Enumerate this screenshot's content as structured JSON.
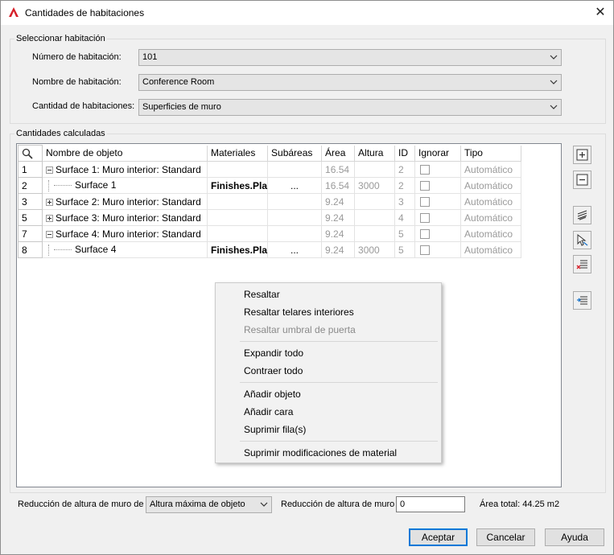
{
  "window": {
    "title": "Cantidades de habitaciones",
    "close": "✕"
  },
  "select_room": {
    "legend": "Seleccionar habitación",
    "number_label": "Número de habitación:",
    "number_value": "101",
    "name_label": "Nombre de habitación:",
    "name_value": "Conference Room",
    "qty_label": "Cantidad de habitaciones:",
    "qty_value": "Superficies de muro"
  },
  "calc": {
    "legend": "Cantidades calculadas",
    "columns": [
      "Nombre de objeto",
      "Materiales",
      "Subáreas",
      "Área",
      "Altura",
      "ID",
      "Ignorar",
      "Tipo"
    ],
    "rows": [
      {
        "num": "1",
        "name": "Surface 1: Muro interior: Standard",
        "material": "",
        "sub": "",
        "area": "16.54",
        "height": "",
        "id": "2",
        "type": "Automático"
      },
      {
        "num": "2",
        "name": "Surface 1",
        "material": "Finishes.Pla",
        "sub": "...",
        "area": "16.54",
        "height": "3000",
        "id": "2",
        "type": "Automático"
      },
      {
        "num": "3",
        "name": "Surface 2: Muro interior: Standard",
        "material": "",
        "sub": "",
        "area": "9.24",
        "height": "",
        "id": "3",
        "type": "Automático"
      },
      {
        "num": "5",
        "name": "Surface 3: Muro interior: Standard",
        "material": "",
        "sub": "",
        "area": "9.24",
        "height": "",
        "id": "4",
        "type": "Automático"
      },
      {
        "num": "7",
        "name": "Surface 4: Muro interior: Standard",
        "material": "",
        "sub": "",
        "area": "9.24",
        "height": "",
        "id": "5",
        "type": "Automático"
      },
      {
        "num": "8",
        "name": "Surface 4",
        "material": "Finishes.Pla",
        "sub": "...",
        "area": "9.24",
        "height": "3000",
        "id": "5",
        "type": "Automático"
      }
    ]
  },
  "context_menu": {
    "highlight": "Resaltar",
    "highlight_interior": "Resaltar telares interiores",
    "highlight_door": "Resaltar umbral de puerta",
    "expand_all": "Expandir todo",
    "collapse_all": "Contraer todo",
    "add_object": "Añadir objeto",
    "add_face": "Añadir cara",
    "delete_rows": "Suprimir fila(s)",
    "delete_mat": "Suprimir modificaciones de material"
  },
  "bottom": {
    "reduction_from_label": "Reducción de altura de muro de",
    "reduction_from_value": "Altura máxima de objeto",
    "reduction_label": "Reducción de altura de muro",
    "reduction_value": "0",
    "total_area": "Área total: 44.25 m2"
  },
  "buttons": {
    "accept": "Aceptar",
    "cancel": "Cancelar",
    "help": "Ayuda"
  },
  "colors": {
    "accent": "#0078d7",
    "app_icon": "#d6202a",
    "disabled_text": "#9a9a9a"
  }
}
